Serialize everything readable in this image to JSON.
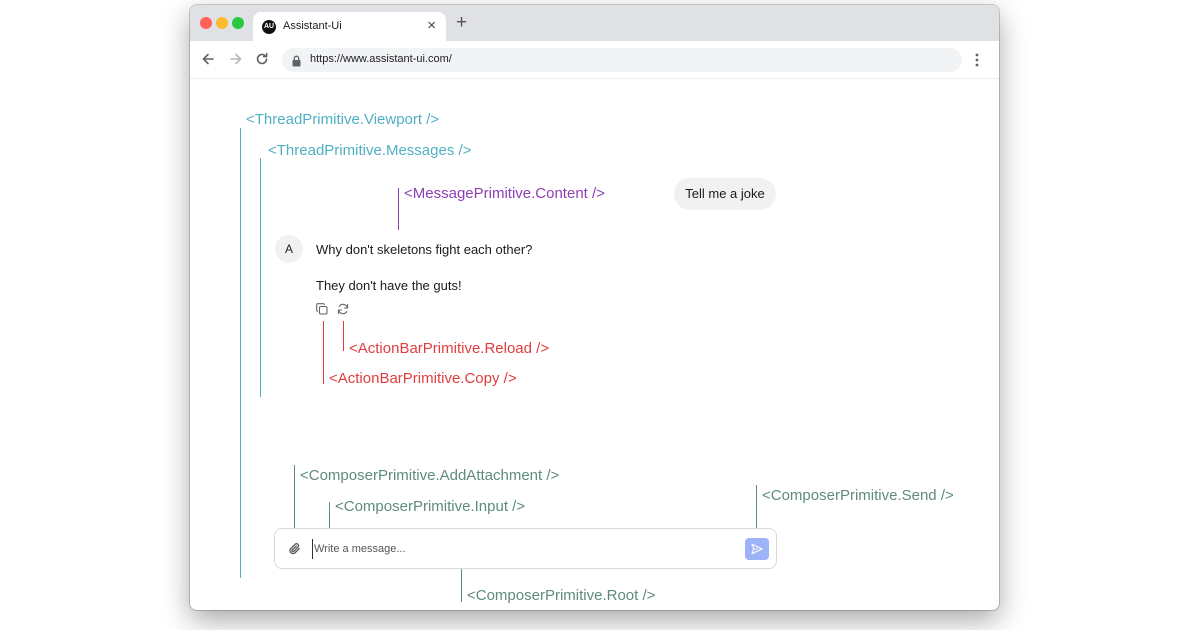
{
  "browser": {
    "tab_title": "Assistant-Ui",
    "tab_favicon_text": "AU",
    "tab_close": "×",
    "new_tab": "+",
    "url": "https://www.assistant-ui.com/"
  },
  "annotations": {
    "viewport": "<ThreadPrimitive.Viewport />",
    "messages": "<ThreadPrimitive.Messages />",
    "message_content": "<MessagePrimitive.Content />",
    "reload": "<ActionBarPrimitive.Reload />",
    "copy": "<ActionBarPrimitive.Copy />",
    "add_attachment": "<ComposerPrimitive.AddAttachment />",
    "input": "<ComposerPrimitive.Input />",
    "send": "<ComposerPrimitive.Send />",
    "root": "<ComposerPrimitive.Root />"
  },
  "thread": {
    "user_message": "Tell me a joke",
    "assistant_avatar": "A",
    "assistant_lines": [
      "Why don't skeletons fight each other?",
      "They don't have the guts!"
    ]
  },
  "composer": {
    "placeholder": "Write a message..."
  },
  "colors": {
    "thread_annotation": "#4fb0c4",
    "message_annotation": "#8d3fb3",
    "actionbar_annotation": "#e03e3e",
    "composer_annotation": "#5e8b7e",
    "send_button": "#9db3f7"
  },
  "icons": {
    "back": "arrow-left-icon",
    "forward": "arrow-right-icon",
    "reload": "reload-icon",
    "lock": "lock-icon",
    "menu": "kebab-menu-icon",
    "copy": "copy-icon",
    "regenerate": "refresh-icon",
    "attach": "paperclip-icon",
    "send": "send-icon"
  }
}
